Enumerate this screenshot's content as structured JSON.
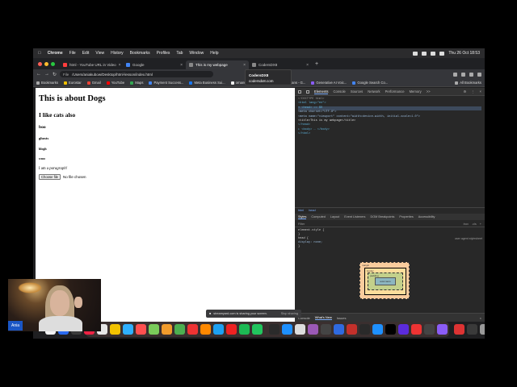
{
  "menubar": {
    "app": "Chrome",
    "items": [
      "File",
      "Edit",
      "View",
      "History",
      "Bookmarks",
      "Profiles",
      "Tab",
      "Window",
      "Help"
    ],
    "datetime": "Thu 26 Oct  18:53"
  },
  "tabs": [
    {
      "title": "html - YouTube URL in Video",
      "active": false,
      "fav": "#ff3d3d"
    },
    {
      "title": "Google",
      "active": false,
      "fav": "#4285f4"
    },
    {
      "title": "This is my webpage",
      "active": true,
      "fav": "#9aa0a6"
    },
    {
      "title": "CodersDX8",
      "active": false,
      "fav": "#9aa0a6"
    }
  ],
  "tooltip": {
    "title": "CodersDX8",
    "url": "codersdx8.com"
  },
  "urlbar": {
    "scheme": "File",
    "path": "/Users/aniakubow/Desktop/html-lesson/index.html"
  },
  "bookmarks": [
    {
      "label": "Bookmarks",
      "color": "#aaa"
    },
    {
      "label": "Eurostar",
      "color": "#f2c200"
    },
    {
      "label": "Gmail",
      "color": "#ea4335"
    },
    {
      "label": "YouTube",
      "color": "#ff0000"
    },
    {
      "label": "Maps",
      "color": "#34a853"
    },
    {
      "label": "Payment Success...",
      "color": "#4285f4"
    },
    {
      "label": "Meta Business Sui...",
      "color": "#1877f2"
    },
    {
      "label": "ornanu",
      "color": "#eee"
    }
  ],
  "bookmarks_right": [
    {
      "label": "mans - G...",
      "color": "#4285f4"
    },
    {
      "label": "Generative AI Voic...",
      "color": "#8a5cf5"
    },
    {
      "label": "Google Search Co...",
      "color": "#4285f4"
    }
  ],
  "all_bookmarks": "All Bookmarks",
  "page": {
    "h1": "This is about Dogs",
    "h2": "I like cats also",
    "h3": "boo",
    "h4": "ghosts",
    "h5": "blogh",
    "h6": "wooo",
    "p_text": "I am a ",
    "p_em": "paragraph!",
    "file_button": "Choose file",
    "file_status": "No file chosen"
  },
  "devtools": {
    "tabs": [
      "Elements",
      "Console",
      "Sources",
      "Network",
      "Performance",
      "Memory",
      ">>"
    ],
    "active_tab": "Elements",
    "dom_lines": [
      "<!DOCTYPE html>",
      "<html lang=\"en\">",
      "▾ <head> == $0",
      "    <meta charset=\"UTF-8\">",
      "    <meta name=\"viewport\" content=\"width=device-width, initial-scale=1.0\">",
      "    <title>This is my webpage</title>",
      "  </head>",
      "▸ <body> … </body>",
      "</html>"
    ],
    "crumbs": [
      "html",
      "head"
    ],
    "style_tabs": [
      "Styles",
      "Computed",
      "Layout",
      "Event Listeners",
      "DOM Breakpoints",
      "Properties",
      "Accessibility"
    ],
    "filter_placeholder": "Filter",
    "filter_right": [
      ":hov",
      ".cls",
      "+"
    ],
    "element_style": "element.style {",
    "element_style_close": "}",
    "rule_selector": "head {",
    "rule_prop": "  display: none;",
    "rule_close": "}",
    "ua_label": "user agent stylesheet",
    "box_labels": {
      "margin": "margin",
      "border": "border",
      "padding": "padding",
      "content": "auto×auto"
    },
    "drawer_tabs": [
      "Console",
      "What's New",
      "Issues"
    ],
    "drawer_active": "What's New"
  },
  "share": {
    "text": "streamyard.com is sharing your screen.",
    "stop": "Stop sharing"
  },
  "dock_colors": [
    "#f2f2f2",
    "#2a6af0",
    "#3c3c3c",
    "#e24",
    "#e7e7e7",
    "#f2c200",
    "#2fb0ff",
    "#ff4f4f",
    "#7acb5a",
    "#f19b2c",
    "#4caf50",
    "#e33",
    "#ff8800",
    "#1da1f2",
    "#e22",
    "#1db954",
    "#22c55e",
    "#2b2b2b",
    "#1e90ff",
    "#ddd",
    "#9b59b6",
    "#444",
    "#2f6ae0",
    "#c4302b",
    "#2a2a2a",
    "#1e90ff",
    "#000",
    "#5b2bdc",
    "#e33",
    "#444",
    "#8b5cf6",
    "#d33",
    "#3a3a3a",
    "#999"
  ],
  "webcam_name": "Ania"
}
